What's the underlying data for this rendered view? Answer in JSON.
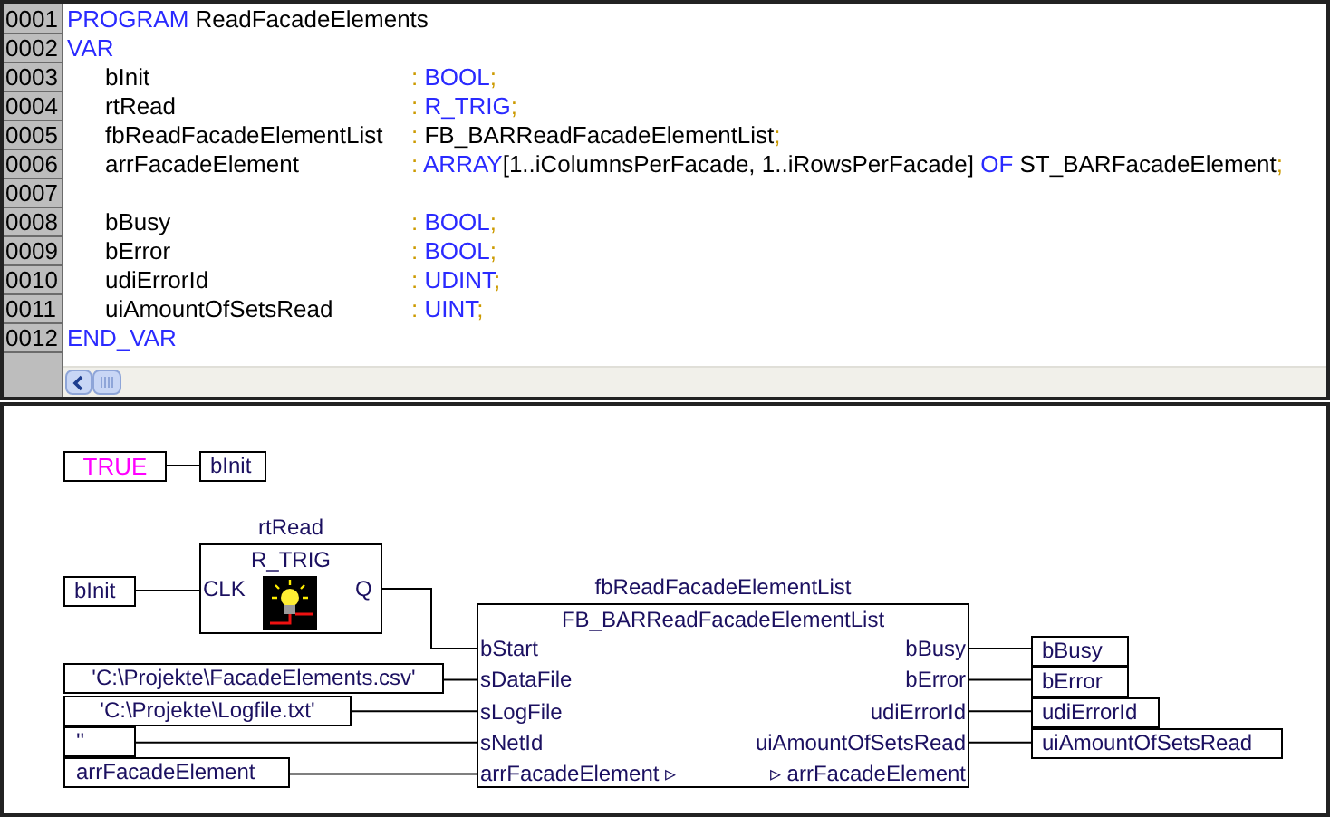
{
  "editor": {
    "lines": [
      {
        "number": "0001",
        "code": [
          {
            "kind": "keyword",
            "text": "PROGRAM"
          },
          {
            "kind": "plain",
            "text": " ReadFacadeElements"
          }
        ]
      },
      {
        "number": "0002",
        "code": [
          {
            "kind": "keyword",
            "text": "VAR"
          }
        ]
      },
      {
        "number": "0003",
        "name": "bInit",
        "code": [
          {
            "kind": "punct",
            "text": ": "
          },
          {
            "kind": "keyword",
            "text": "BOOL"
          },
          {
            "kind": "punct",
            "text": ";"
          }
        ]
      },
      {
        "number": "0004",
        "name": "rtRead",
        "code": [
          {
            "kind": "punct",
            "text": ": "
          },
          {
            "kind": "keyword",
            "text": "R_TRIG"
          },
          {
            "kind": "punct",
            "text": ";"
          }
        ]
      },
      {
        "number": "0005",
        "name": "fbReadFacadeElementList",
        "code": [
          {
            "kind": "punct",
            "text": ": "
          },
          {
            "kind": "plain",
            "text": "FB_BARReadFacadeElementList"
          },
          {
            "kind": "punct",
            "text": ";"
          }
        ]
      },
      {
        "number": "0006",
        "name": "arrFacadeElement",
        "code": [
          {
            "kind": "punct",
            "text": ": "
          },
          {
            "kind": "keyword",
            "text": "ARRAY"
          },
          {
            "kind": "plain",
            "text": "[1..iColumnsPerFacade, 1..iRowsPerFacade] "
          },
          {
            "kind": "keyword",
            "text": "OF"
          },
          {
            "kind": "plain",
            "text": " ST_BARFacadeElement"
          },
          {
            "kind": "punct",
            "text": ";"
          }
        ]
      },
      {
        "number": "0007"
      },
      {
        "number": "0008",
        "name": "bBusy",
        "code": [
          {
            "kind": "punct",
            "text": ": "
          },
          {
            "kind": "keyword",
            "text": "BOOL"
          },
          {
            "kind": "punct",
            "text": ";"
          }
        ]
      },
      {
        "number": "0009",
        "name": "bError",
        "code": [
          {
            "kind": "punct",
            "text": ": "
          },
          {
            "kind": "keyword",
            "text": "BOOL"
          },
          {
            "kind": "punct",
            "text": ";"
          }
        ]
      },
      {
        "number": "0010",
        "name": "udiErrorId",
        "code": [
          {
            "kind": "punct",
            "text": ": "
          },
          {
            "kind": "keyword",
            "text": "UDINT"
          },
          {
            "kind": "punct",
            "text": ";"
          }
        ]
      },
      {
        "number": "0011",
        "name": "uiAmountOfSetsRead",
        "code": [
          {
            "kind": "punct",
            "text": ": "
          },
          {
            "kind": "keyword",
            "text": "UINT"
          },
          {
            "kind": "punct",
            "text": ";"
          }
        ]
      },
      {
        "number": "0012",
        "code": [
          {
            "kind": "keyword",
            "text": "END_VAR"
          }
        ]
      }
    ]
  },
  "diagram": {
    "constant": {
      "value": "TRUE",
      "target": "bInit"
    },
    "trigger": {
      "instance": "rtRead",
      "type": "R_TRIG",
      "input_pin": "CLK",
      "output_pin": "Q",
      "input_var": "bInit"
    },
    "block": {
      "instance": "fbReadFacadeElementList",
      "type": "FB_BARReadFacadeElementList",
      "inputs": [
        {
          "pin": "bStart"
        },
        {
          "pin": "sDataFile",
          "arg": "'C:\\Projekte\\FacadeElements.csv'"
        },
        {
          "pin": "sLogFile",
          "arg": "'C:\\Projekte\\Logfile.txt'"
        },
        {
          "pin": "sNetId",
          "arg": "''"
        },
        {
          "pin": "arrFacadeElement ▹",
          "arg": "arrFacadeElement"
        }
      ],
      "outputs": [
        {
          "pin": "bBusy",
          "arg": "bBusy"
        },
        {
          "pin": "bError",
          "arg": "bError"
        },
        {
          "pin": "udiErrorId",
          "arg": "udiErrorId"
        },
        {
          "pin": "uiAmountOfSetsRead",
          "arg": "uiAmountOfSetsRead"
        },
        {
          "pin": "▹ arrFacadeElement"
        }
      ]
    }
  }
}
